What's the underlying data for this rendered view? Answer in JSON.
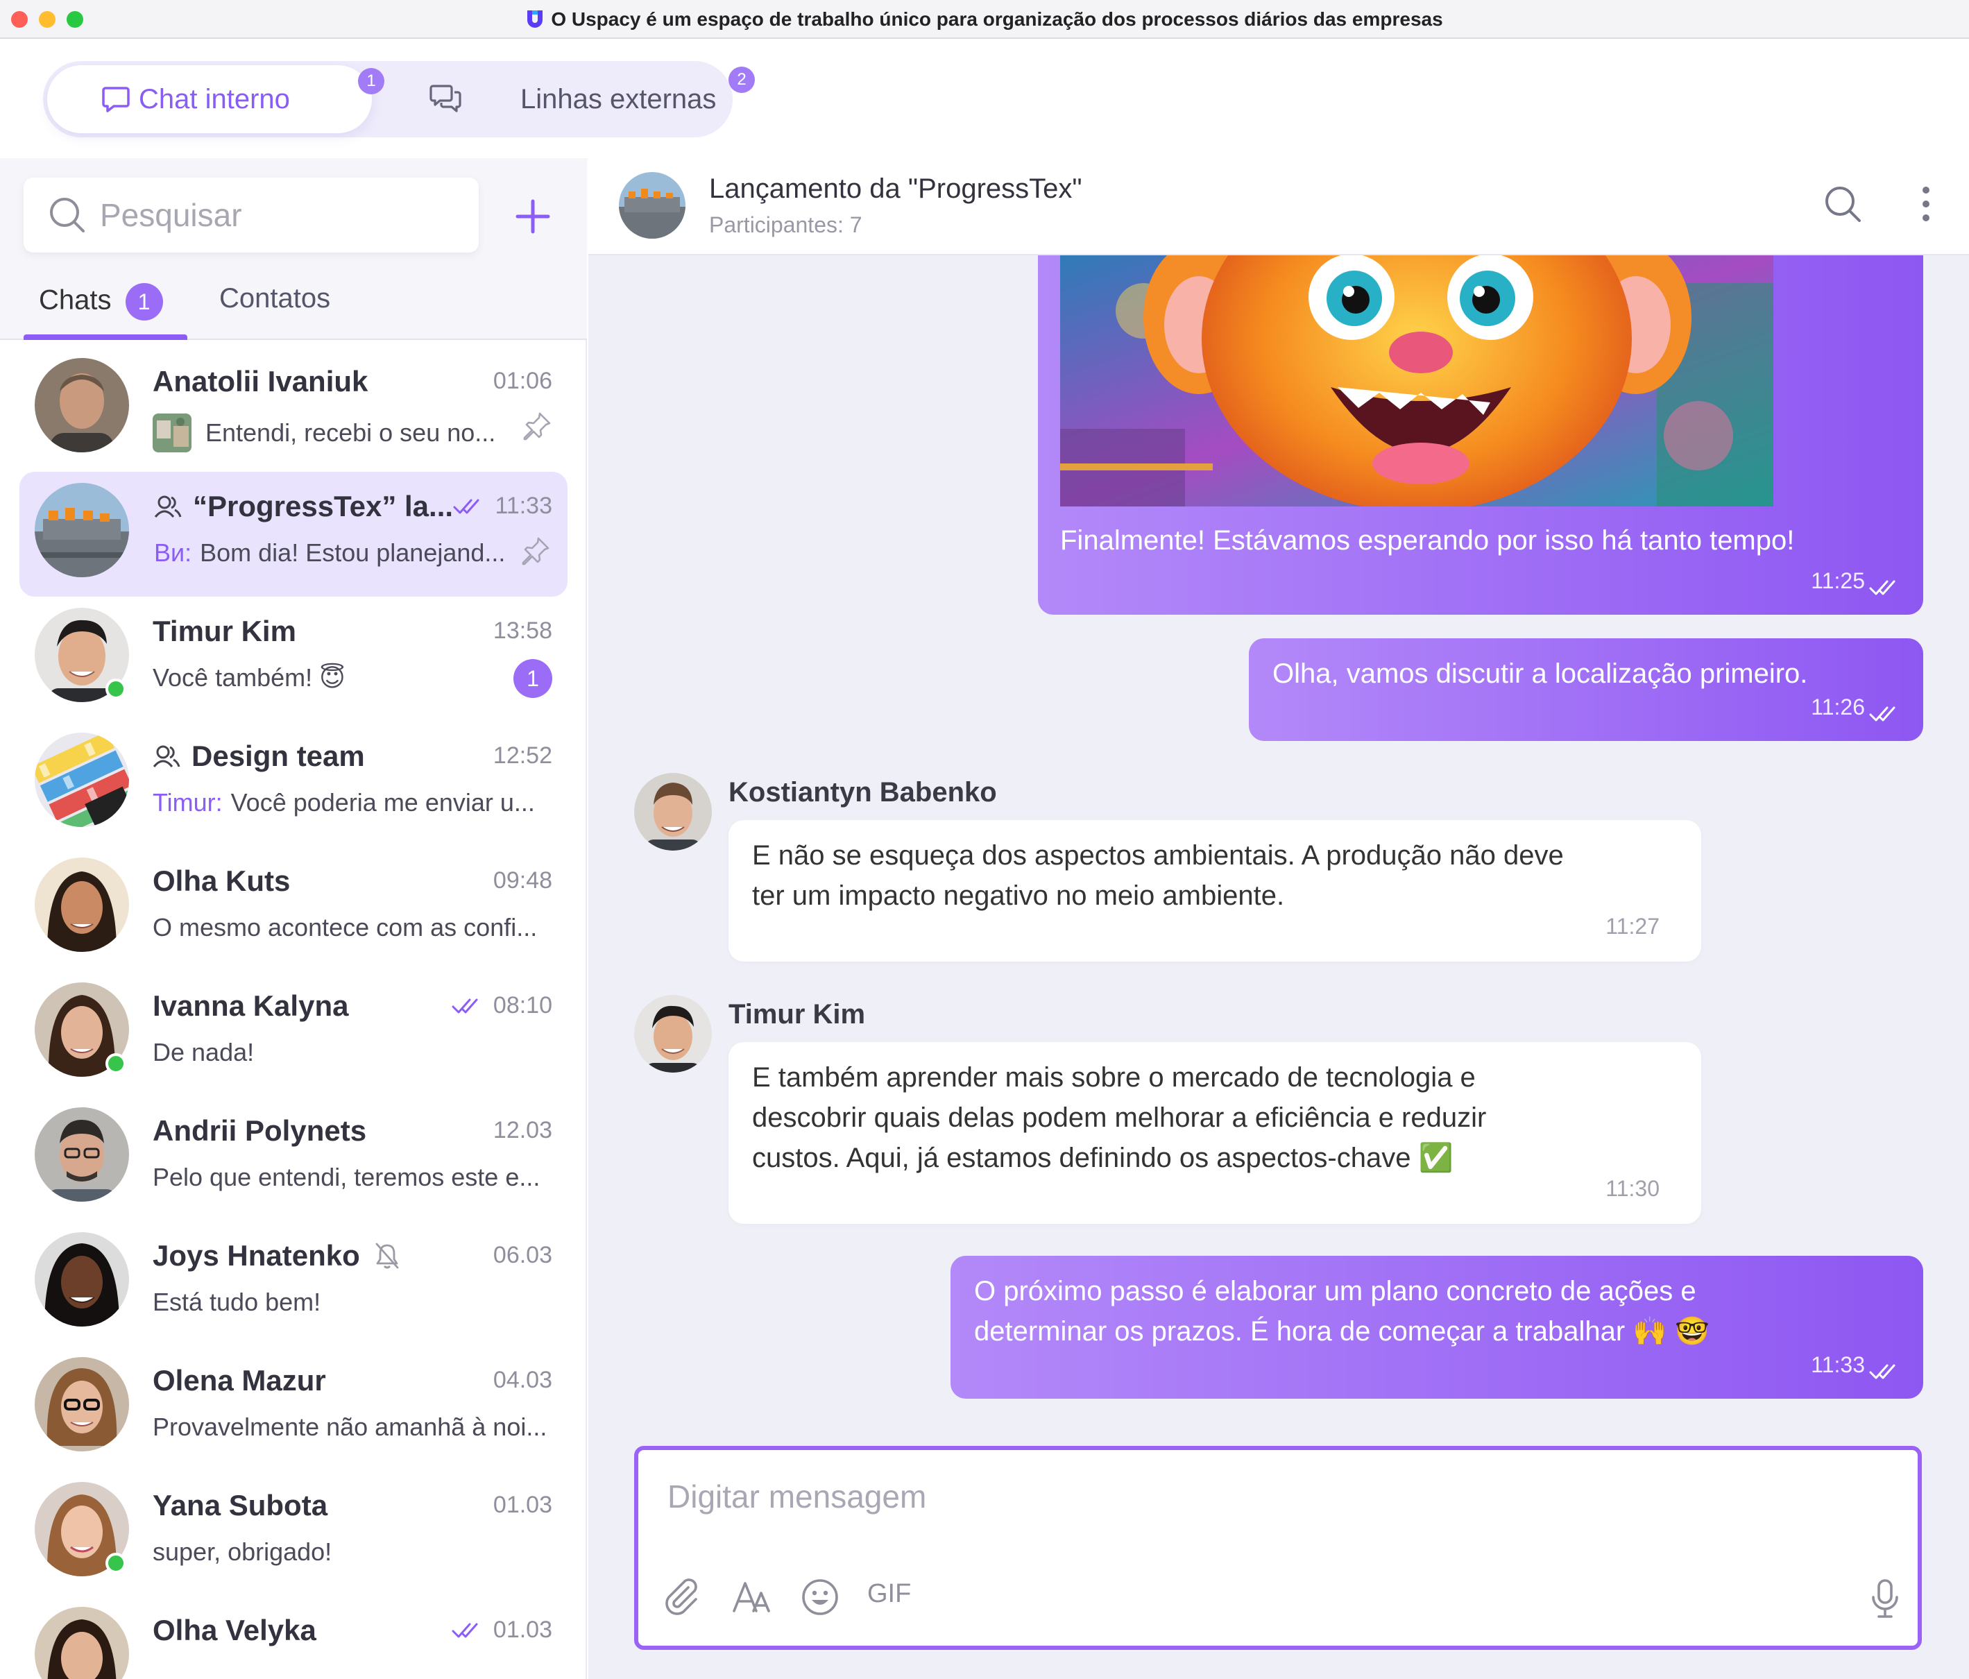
{
  "window": {
    "title": "O Uspacy é um espaço de trabalho único para organização dos processos diários das empresas"
  },
  "top_tabs": [
    {
      "label": "Chat interno",
      "badge": "1"
    },
    {
      "label": "Linhas externas",
      "badge": "2"
    }
  ],
  "sidebar": {
    "search_placeholder": "Pesquisar",
    "tabs": {
      "chats": "Chats",
      "chats_badge": "1",
      "contacts": "Contatos"
    },
    "chats": [
      {
        "name": "Anatolii Ivaniuk",
        "time": "01:06",
        "message": "Entendi, recebi o seu no..."
      },
      {
        "name": "“ProgressTex” la...",
        "time": "11:33",
        "prefix": "Ви:",
        "message": "Bom dia! Estou planejand..."
      },
      {
        "name": "Timur Kim",
        "time": "13:58",
        "message": "Você também! 😇",
        "unread": "1"
      },
      {
        "name": "Design team",
        "time": "12:52",
        "prefix": "Timur:",
        "message": "Você poderia me enviar u..."
      },
      {
        "name": "Olha Kuts",
        "time": "09:48",
        "message": "O mesmo acontece com as confi..."
      },
      {
        "name": "Ivanna Kalyna",
        "time": "08:10",
        "message": "De nada!"
      },
      {
        "name": "Andrii Polynets",
        "time": "12.03",
        "message": "Pelo que entendi, teremos este e..."
      },
      {
        "name": "Joys Hnatenko",
        "time": "06.03",
        "message": "Está tudo bem!"
      },
      {
        "name": "Olena Mazur",
        "time": "04.03",
        "message": "Provavelmente não amanhã à noi..."
      },
      {
        "name": "Yana Subota",
        "time": "01.03",
        "message": "super, obrigado!"
      },
      {
        "name": "Olha Velyka",
        "time": "01.03",
        "message": ""
      }
    ]
  },
  "conversation": {
    "title": "Lançamento da \"ProgressTex\"",
    "subtitle": "Participantes: 7",
    "messages": [
      {
        "text": "Finalmente! Estávamos esperando por isso há tanto tempo!",
        "time": "11:25"
      },
      {
        "text": "Olha, vamos discutir a localização primeiro.",
        "time": "11:26"
      },
      {
        "sender": "Kostiantyn Babenko",
        "lines": [
          "E não se esqueça dos aspectos ambientais. A produção não deve",
          "ter um impacto negativo no meio ambiente."
        ],
        "time": "11:27"
      },
      {
        "sender": "Timur Kim",
        "lines": [
          "E também aprender mais sobre o mercado de tecnologia e",
          "descobrir quais delas podem melhorar a eficiência e reduzir",
          "custos. Aqui, já estamos definindo os aspectos-chave ✅"
        ],
        "time": "11:30"
      },
      {
        "lines": [
          "O próximo passo é elaborar um plano concreto de ações e",
          "determinar os prazos. É hora de começar a trabalhar 🙌 🤓"
        ],
        "time": "11:33"
      }
    ],
    "composer_placeholder": "Digitar mensagem",
    "gif_label": "GIF"
  },
  "colors": {
    "accent": "#8b5cf6",
    "bubble_start": "#b389f9",
    "bubble_end": "#8e57f2",
    "online": "#36c44a"
  },
  "icons": [
    "app-logo-icon",
    "chat-bubble-icon",
    "chat-double-bubble-icon",
    "search-icon",
    "plus-icon",
    "pin-icon",
    "group-icon",
    "double-check-icon",
    "bell-off-icon",
    "more-vertical-icon",
    "paperclip-icon",
    "text-format-icon",
    "emoji-icon",
    "microphone-icon"
  ]
}
